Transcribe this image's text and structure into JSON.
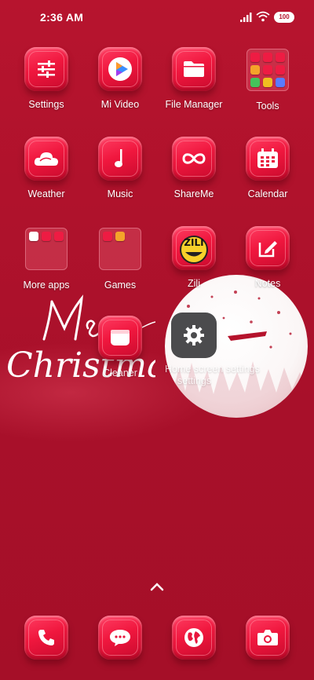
{
  "status_bar": {
    "time": "2:36 AM",
    "battery": "100"
  },
  "apps": [
    {
      "label": "Settings",
      "icon": "sliders-icon"
    },
    {
      "label": "Mi Video",
      "icon": "play-icon"
    },
    {
      "label": "File Manager",
      "icon": "folder-icon"
    },
    {
      "label": "Tools",
      "icon": "folder-tools"
    },
    {
      "label": "Weather",
      "icon": "cloud-icon"
    },
    {
      "label": "Music",
      "icon": "music-note-icon"
    },
    {
      "label": "ShareMe",
      "icon": "infinity-icon"
    },
    {
      "label": "Calendar",
      "icon": "calendar-icon"
    },
    {
      "label": "More apps",
      "icon": "folder-more-apps"
    },
    {
      "label": "Games",
      "icon": "folder-games"
    },
    {
      "label": "Zili",
      "icon": "zili-icon"
    },
    {
      "label": "Notes",
      "icon": "notes-icon"
    }
  ],
  "floating": {
    "cleaner_label": "Cleaner",
    "settings_label": "Home screen settings",
    "settings_label_line2": "settings"
  },
  "wallpaper_text": {
    "line1": "Merry",
    "line2": "Christmas"
  },
  "dock": [
    {
      "name": "phone-icon"
    },
    {
      "name": "messages-icon"
    },
    {
      "name": "browser-icon"
    },
    {
      "name": "camera-icon"
    }
  ]
}
